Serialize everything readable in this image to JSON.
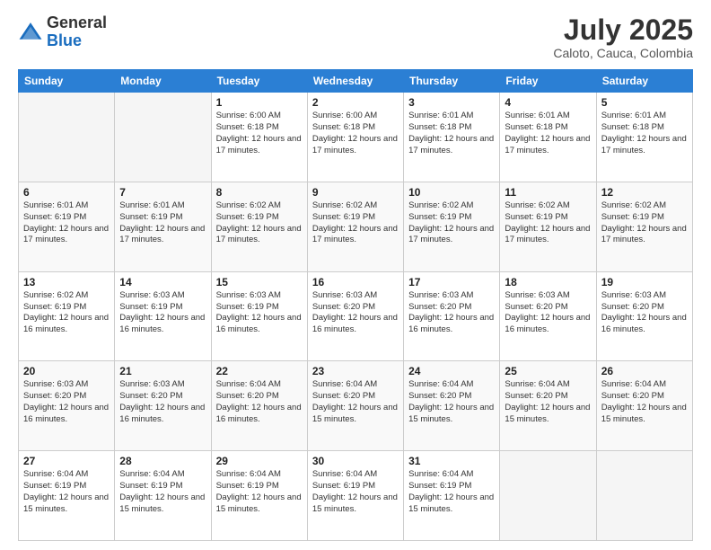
{
  "logo": {
    "general": "General",
    "blue": "Blue"
  },
  "title": "July 2025",
  "location": "Caloto, Cauca, Colombia",
  "days_of_week": [
    "Sunday",
    "Monday",
    "Tuesday",
    "Wednesday",
    "Thursday",
    "Friday",
    "Saturday"
  ],
  "weeks": [
    [
      {
        "day": "",
        "info": ""
      },
      {
        "day": "",
        "info": ""
      },
      {
        "day": "1",
        "info": "Sunrise: 6:00 AM\nSunset: 6:18 PM\nDaylight: 12 hours and 17 minutes."
      },
      {
        "day": "2",
        "info": "Sunrise: 6:00 AM\nSunset: 6:18 PM\nDaylight: 12 hours and 17 minutes."
      },
      {
        "day": "3",
        "info": "Sunrise: 6:01 AM\nSunset: 6:18 PM\nDaylight: 12 hours and 17 minutes."
      },
      {
        "day": "4",
        "info": "Sunrise: 6:01 AM\nSunset: 6:18 PM\nDaylight: 12 hours and 17 minutes."
      },
      {
        "day": "5",
        "info": "Sunrise: 6:01 AM\nSunset: 6:18 PM\nDaylight: 12 hours and 17 minutes."
      }
    ],
    [
      {
        "day": "6",
        "info": "Sunrise: 6:01 AM\nSunset: 6:19 PM\nDaylight: 12 hours and 17 minutes."
      },
      {
        "day": "7",
        "info": "Sunrise: 6:01 AM\nSunset: 6:19 PM\nDaylight: 12 hours and 17 minutes."
      },
      {
        "day": "8",
        "info": "Sunrise: 6:02 AM\nSunset: 6:19 PM\nDaylight: 12 hours and 17 minutes."
      },
      {
        "day": "9",
        "info": "Sunrise: 6:02 AM\nSunset: 6:19 PM\nDaylight: 12 hours and 17 minutes."
      },
      {
        "day": "10",
        "info": "Sunrise: 6:02 AM\nSunset: 6:19 PM\nDaylight: 12 hours and 17 minutes."
      },
      {
        "day": "11",
        "info": "Sunrise: 6:02 AM\nSunset: 6:19 PM\nDaylight: 12 hours and 17 minutes."
      },
      {
        "day": "12",
        "info": "Sunrise: 6:02 AM\nSunset: 6:19 PM\nDaylight: 12 hours and 17 minutes."
      }
    ],
    [
      {
        "day": "13",
        "info": "Sunrise: 6:02 AM\nSunset: 6:19 PM\nDaylight: 12 hours and 16 minutes."
      },
      {
        "day": "14",
        "info": "Sunrise: 6:03 AM\nSunset: 6:19 PM\nDaylight: 12 hours and 16 minutes."
      },
      {
        "day": "15",
        "info": "Sunrise: 6:03 AM\nSunset: 6:19 PM\nDaylight: 12 hours and 16 minutes."
      },
      {
        "day": "16",
        "info": "Sunrise: 6:03 AM\nSunset: 6:20 PM\nDaylight: 12 hours and 16 minutes."
      },
      {
        "day": "17",
        "info": "Sunrise: 6:03 AM\nSunset: 6:20 PM\nDaylight: 12 hours and 16 minutes."
      },
      {
        "day": "18",
        "info": "Sunrise: 6:03 AM\nSunset: 6:20 PM\nDaylight: 12 hours and 16 minutes."
      },
      {
        "day": "19",
        "info": "Sunrise: 6:03 AM\nSunset: 6:20 PM\nDaylight: 12 hours and 16 minutes."
      }
    ],
    [
      {
        "day": "20",
        "info": "Sunrise: 6:03 AM\nSunset: 6:20 PM\nDaylight: 12 hours and 16 minutes."
      },
      {
        "day": "21",
        "info": "Sunrise: 6:03 AM\nSunset: 6:20 PM\nDaylight: 12 hours and 16 minutes."
      },
      {
        "day": "22",
        "info": "Sunrise: 6:04 AM\nSunset: 6:20 PM\nDaylight: 12 hours and 16 minutes."
      },
      {
        "day": "23",
        "info": "Sunrise: 6:04 AM\nSunset: 6:20 PM\nDaylight: 12 hours and 15 minutes."
      },
      {
        "day": "24",
        "info": "Sunrise: 6:04 AM\nSunset: 6:20 PM\nDaylight: 12 hours and 15 minutes."
      },
      {
        "day": "25",
        "info": "Sunrise: 6:04 AM\nSunset: 6:20 PM\nDaylight: 12 hours and 15 minutes."
      },
      {
        "day": "26",
        "info": "Sunrise: 6:04 AM\nSunset: 6:20 PM\nDaylight: 12 hours and 15 minutes."
      }
    ],
    [
      {
        "day": "27",
        "info": "Sunrise: 6:04 AM\nSunset: 6:19 PM\nDaylight: 12 hours and 15 minutes."
      },
      {
        "day": "28",
        "info": "Sunrise: 6:04 AM\nSunset: 6:19 PM\nDaylight: 12 hours and 15 minutes."
      },
      {
        "day": "29",
        "info": "Sunrise: 6:04 AM\nSunset: 6:19 PM\nDaylight: 12 hours and 15 minutes."
      },
      {
        "day": "30",
        "info": "Sunrise: 6:04 AM\nSunset: 6:19 PM\nDaylight: 12 hours and 15 minutes."
      },
      {
        "day": "31",
        "info": "Sunrise: 6:04 AM\nSunset: 6:19 PM\nDaylight: 12 hours and 15 minutes."
      },
      {
        "day": "",
        "info": ""
      },
      {
        "day": "",
        "info": ""
      }
    ]
  ]
}
